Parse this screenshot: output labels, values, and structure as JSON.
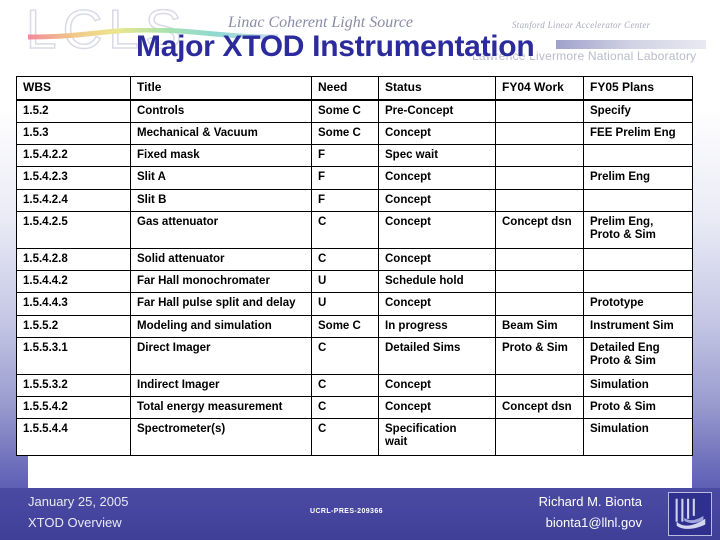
{
  "header": {
    "logo_wordmark": "LCLS",
    "logo_tagline": "Linac Coherent Light Source",
    "slac_label": "Stanford Linear Accelerator Center",
    "llnl_label": "Lawrence Livermore National Laboratory",
    "title": "Major XTOD Instrumentation",
    "title_color": "#2b2b9e"
  },
  "table": {
    "columns": [
      "WBS",
      "Title",
      "Need",
      "Status",
      "FY04 Work",
      "FY05 Plans"
    ],
    "rows": [
      {
        "wbs": "1.5.2",
        "title": "Controls",
        "need": "Some C",
        "status": "Pre-Concept",
        "fy04": "",
        "fy05": "Specify",
        "tall": false
      },
      {
        "wbs": "1.5.3",
        "title": "Mechanical & Vacuum",
        "need": "Some C",
        "status": "Concept",
        "fy04": "",
        "fy05": "FEE Prelim Eng",
        "tall": false
      },
      {
        "wbs": "1.5.4.2.2",
        "title": "Fixed mask",
        "need": "F",
        "status": "Spec wait",
        "fy04": "",
        "fy05": "",
        "tall": false
      },
      {
        "wbs": "1.5.4.2.3",
        "title": "Slit A",
        "need": "F",
        "status": "Concept",
        "fy04": "",
        "fy05": "Prelim Eng",
        "tall": false
      },
      {
        "wbs": "1.5.4.2.4",
        "title": "Slit B",
        "need": "F",
        "status": "Concept",
        "fy04": "",
        "fy05": "",
        "tall": false
      },
      {
        "wbs": "1.5.4.2.5",
        "title": "Gas attenuator",
        "need": "C",
        "status": "Concept",
        "fy04": "Concept dsn",
        "fy05": "Prelim Eng,\nProto & Sim",
        "tall": true
      },
      {
        "wbs": "1.5.4.2.8",
        "title": "Solid attenuator",
        "need": "C",
        "status": "Concept",
        "fy04": "",
        "fy05": "",
        "tall": false
      },
      {
        "wbs": "1.5.4.4.2",
        "title": "Far Hall monochromater",
        "need": "U",
        "status": "Schedule hold",
        "fy04": "",
        "fy05": "",
        "tall": false
      },
      {
        "wbs": "1.5.4.4.3",
        "title": "Far Hall pulse split and delay",
        "need": "U",
        "status": "Concept",
        "fy04": "",
        "fy05": "Prototype",
        "tall": false
      },
      {
        "wbs": "1.5.5.2",
        "title": "Modeling and simulation",
        "need": "Some C",
        "status": "In progress",
        "fy04": "Beam Sim",
        "fy05": "Instrument Sim",
        "tall": false
      },
      {
        "wbs": "1.5.5.3.1",
        "title": "Direct Imager",
        "need": "C",
        "status": "Detailed Sims",
        "fy04": "Proto & Sim",
        "fy05": "Detailed Eng\nProto & Sim",
        "tall": true
      },
      {
        "wbs": "1.5.5.3.2",
        "title": "Indirect Imager",
        "need": "C",
        "status": "Concept",
        "fy04": "",
        "fy05": "Simulation",
        "tall": false
      },
      {
        "wbs": "1.5.5.4.2",
        "title": "Total energy measurement",
        "need": "C",
        "status": "Concept",
        "fy04": "Concept dsn",
        "fy05": "Proto & Sim",
        "tall": false
      },
      {
        "wbs": "1.5.5.4.4",
        "title": "Spectrometer(s)",
        "need": "C",
        "status": "Specification\nwait",
        "fy04": "",
        "fy05": "Simulation",
        "tall": true
      }
    ]
  },
  "footer": {
    "date": "January 25, 2005",
    "subtitle": "XTOD  Overview",
    "ucrl": "UCRL-PRES-209366",
    "author": "Richard M. Bionta",
    "email": "bionta1@llnl.gov",
    "logo_name": "llnl-logo",
    "background_color": "#4646a0"
  }
}
